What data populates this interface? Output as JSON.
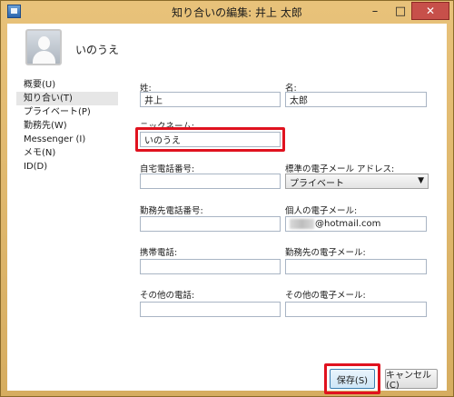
{
  "window": {
    "title": "知り合いの編集: 井上 太郎"
  },
  "titlebar_buttons": {
    "minimize": "–",
    "maximize": "□",
    "close": "✕"
  },
  "contact": {
    "display_name": "いのうえ"
  },
  "nav": {
    "items": [
      {
        "label": "概要(U)",
        "selected": false
      },
      {
        "label": "知り合い(T)",
        "selected": true
      },
      {
        "label": "プライベート(P)",
        "selected": false
      },
      {
        "label": "勤務先(W)",
        "selected": false
      },
      {
        "label": "Messenger (I)",
        "selected": false
      },
      {
        "label": "メモ(N)",
        "selected": false
      },
      {
        "label": "ID(D)",
        "selected": false
      }
    ]
  },
  "form": {
    "last_name": {
      "label": "姓:",
      "value": "井上"
    },
    "first_name": {
      "label": "名:",
      "value": "太郎"
    },
    "nickname": {
      "label": "ニックネーム:",
      "value": "いのうえ"
    },
    "home_phone": {
      "label": "自宅電話番号:",
      "value": ""
    },
    "default_email": {
      "label": "標準の電子メール アドレス:",
      "value": "プライベート"
    },
    "work_phone": {
      "label": "勤務先電話番号:",
      "value": ""
    },
    "personal_email": {
      "label": "個人の電子メール:",
      "value": "@hotmail.com"
    },
    "mobile_phone": {
      "label": "携帯電話:",
      "value": ""
    },
    "work_email": {
      "label": "勤務先の電子メール:",
      "value": ""
    },
    "other_phone": {
      "label": "その他の電話:",
      "value": ""
    },
    "other_email": {
      "label": "その他の電子メール:",
      "value": ""
    }
  },
  "buttons": {
    "save": "保存(S)",
    "cancel": "キャンセル(C)"
  },
  "colors": {
    "highlight": "#e0121f",
    "title_bar": "#d9b36c"
  }
}
